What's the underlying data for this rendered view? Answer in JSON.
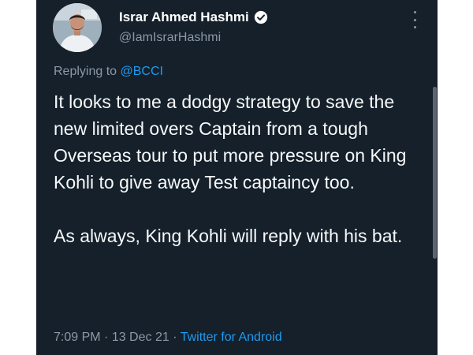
{
  "author": {
    "display_name": "Israr Ahmed Hashmi",
    "handle": "@IamIsrarHashmi",
    "verified": true
  },
  "reply": {
    "prefix": "Replying to ",
    "mention": "@BCCI"
  },
  "tweet": {
    "text": "It looks to me a dodgy strategy to save the new limited overs Captain from a tough Overseas tour to put more pressure on King Kohli to give away Test captaincy too.\n\nAs always, King Kohli will reply with his bat."
  },
  "meta": {
    "time": "7:09 PM",
    "separator": " · ",
    "date": "13 Dec 21",
    "source": "Twitter for Android"
  },
  "colors": {
    "background": "#15202b",
    "text": "#f7f9f9",
    "secondary": "#8b98a5",
    "accent": "#1d9bf0"
  },
  "icons": [
    "avatar-photo",
    "verified-badge-icon",
    "more-options-icon"
  ]
}
